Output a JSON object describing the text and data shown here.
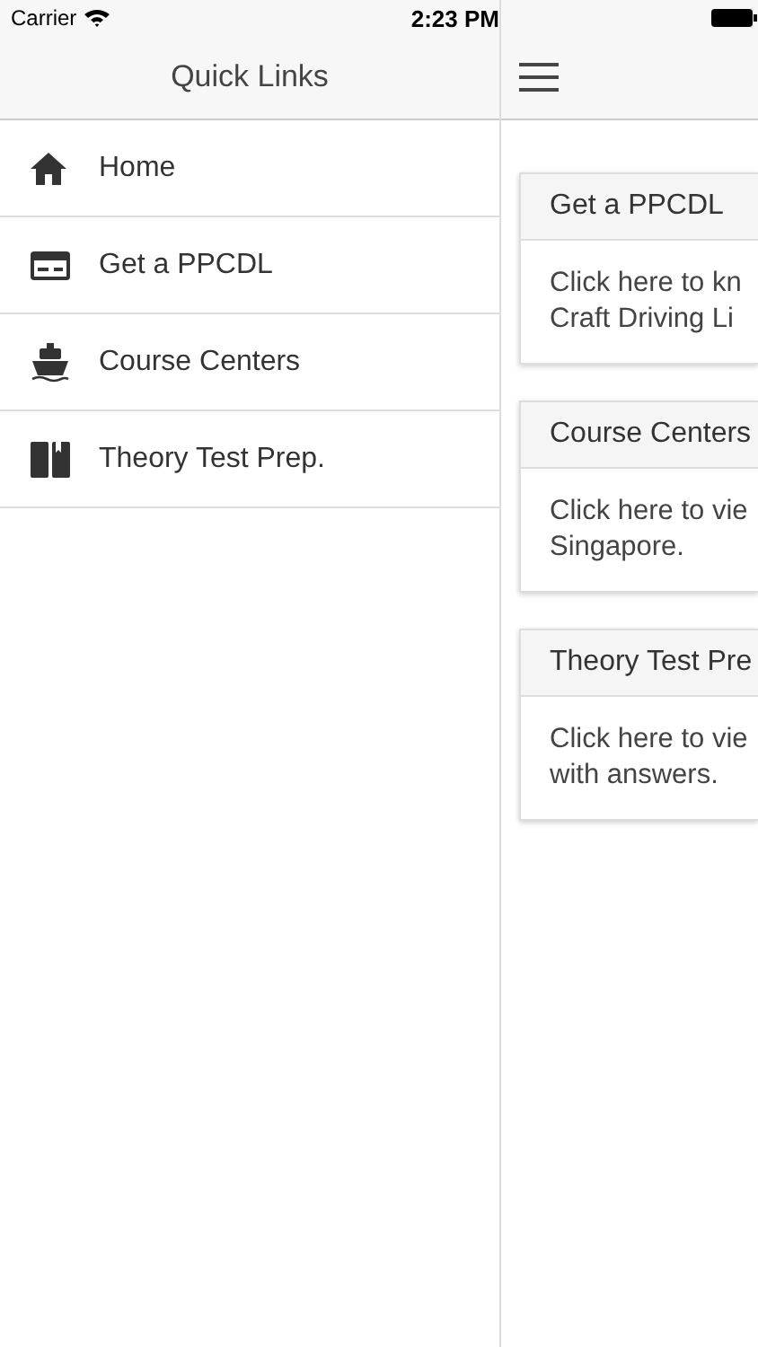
{
  "status_bar": {
    "carrier": "Carrier",
    "time": "2:23 PM"
  },
  "drawer": {
    "title": "Quick Links",
    "items": [
      {
        "label": "Home"
      },
      {
        "label": "Get a PPCDL"
      },
      {
        "label": "Course Centers"
      },
      {
        "label": "Theory Test Prep."
      }
    ]
  },
  "main": {
    "cards": [
      {
        "title": "Get a PPCDL",
        "lines": [
          "Click here to kn",
          "Craft Driving Li"
        ]
      },
      {
        "title": "Course Centers",
        "lines": [
          "Click here to vie",
          "Singapore."
        ]
      },
      {
        "title": "Theory Test Pre",
        "lines": [
          "Click here to vie",
          "with answers."
        ]
      }
    ]
  }
}
